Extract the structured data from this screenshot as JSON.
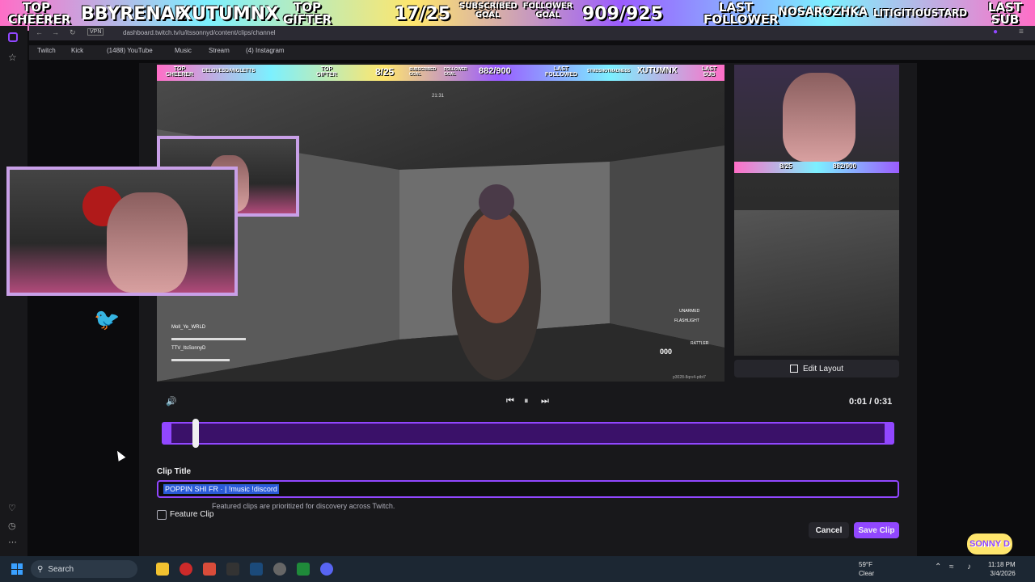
{
  "overlay": {
    "left_labels": [
      {
        "top": "TOP",
        "bottom": "CHEERER"
      },
      {
        "name": "BBYRENAE"
      },
      {
        "name": "XUTUMNX"
      },
      {
        "top": "TOP",
        "bottom": "GIFTER"
      }
    ],
    "subscribed_goal": {
      "count": "17/25",
      "label_top": "SUBSCRIBED",
      "label_bottom": "GOAL"
    },
    "follower_goal": {
      "label_top": "FOLLOWER",
      "label_bottom": "GOAL",
      "count": "909/925"
    },
    "right_labels": [
      {
        "top": "LAST",
        "bottom": "FOLLOWER"
      },
      {
        "name": "NOSAROZHKA"
      },
      {
        "name": "LITIGITIOUSTARD"
      },
      {
        "top": "LAST",
        "bottom": "SUB"
      }
    ]
  },
  "browser": {
    "url": "dashboard.twitch.tv/u/itssonnyd/content/clips/channel",
    "vpn": "VPN"
  },
  "bookmarks": [
    "Twitch",
    "Kick",
    "(1488) YouTube",
    "Music",
    "Stream",
    "(4) Instagram"
  ],
  "inner_overlay": {
    "top_cheerer": "TOP CHEERER",
    "cheerer_name": "DELOVESDANGLETTS",
    "top_gifter": "TOP GIFTER",
    "sub_count": "8/25",
    "subscribed_goal": "SUBSCRIBED GOAL",
    "follower_goal": "FOLLOWER GOAL",
    "follower_count": "882/900",
    "last_followed": "LAST FOLLOWED",
    "last_name": "STMDSNOTMADNESS",
    "last_name2": "XUTUMNX",
    "last_sub": "LAST SUB",
    "timer": "21:31"
  },
  "game_hud": {
    "player1": "Moll_Ye_WRLD",
    "player2": "TTV_ItsSonnyD",
    "unarmed": "UNARMED",
    "flashlight": "FLASHLIGHT",
    "ammo": "000",
    "rattler": "RATTLER",
    "session": "p3028-8qrv4-ptbt7"
  },
  "side_cam": {
    "count": "8/25",
    "count2": "882/900"
  },
  "edit_layout": "Edit Layout",
  "player": {
    "time": "0:01 / 0:31"
  },
  "clip": {
    "title_label": "Clip Title",
    "title_value": "POPPIN SHI FR · | !music !discord",
    "feature_note": "Featured clips are prioritized for discovery across Twitch.",
    "feature_label": "Feature Clip",
    "cancel": "Cancel",
    "save": "Save Clip"
  },
  "taskbar": {
    "search": "Search",
    "temp": "59°F",
    "weather": "Clear",
    "time": "11:18 PM",
    "date": "3/4/2026"
  },
  "brand_badge": "SONNY D",
  "colors": {
    "accent": "#9147ff",
    "bg": "#18181b",
    "selection": "#2a5bd8"
  }
}
